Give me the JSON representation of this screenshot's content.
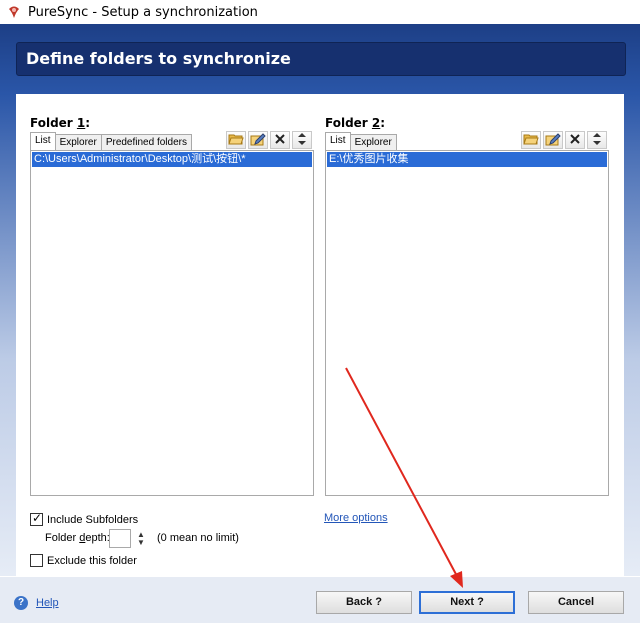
{
  "window": {
    "title": "PureSync - Setup a synchronization"
  },
  "banner": {
    "title": "Define folders to synchronize"
  },
  "folder1": {
    "label_prefix": "Folder ",
    "label_number": "1",
    "label_suffix": ":",
    "tabs": [
      "List",
      "Explorer",
      "Predefined folders"
    ],
    "active_tab": "List",
    "entries": [
      "C:\\Users\\Administrator\\Desktop\\测试\\按钮\\*"
    ]
  },
  "folder2": {
    "label_prefix": "Folder ",
    "label_number": "2",
    "label_suffix": ":",
    "tabs": [
      "List",
      "Explorer"
    ],
    "active_tab": "List",
    "entries": [
      "E:\\优秀图片收集"
    ]
  },
  "toolbar": {
    "icons": [
      "open-folder-icon",
      "edit-icon",
      "delete-icon",
      "move-up-down-icon"
    ]
  },
  "options": {
    "include_subfolders": {
      "label": "Include Subfolders",
      "checked": true
    },
    "folder_depth": {
      "label_prefix": "Folder ",
      "label_underlined": "d",
      "label_suffix": "epth:",
      "value": "",
      "hint": "(0 mean no limit)"
    },
    "exclude_folder": {
      "label": "Exclude this folder",
      "checked": false
    },
    "more_options": "More options"
  },
  "footer": {
    "help": "Help",
    "back": "Back ?",
    "next": "Next ?",
    "cancel": "Cancel"
  },
  "colors": {
    "banner": "#2a56a8",
    "selection": "#2a6bd6",
    "annotation_arrow": "#e0281e"
  }
}
